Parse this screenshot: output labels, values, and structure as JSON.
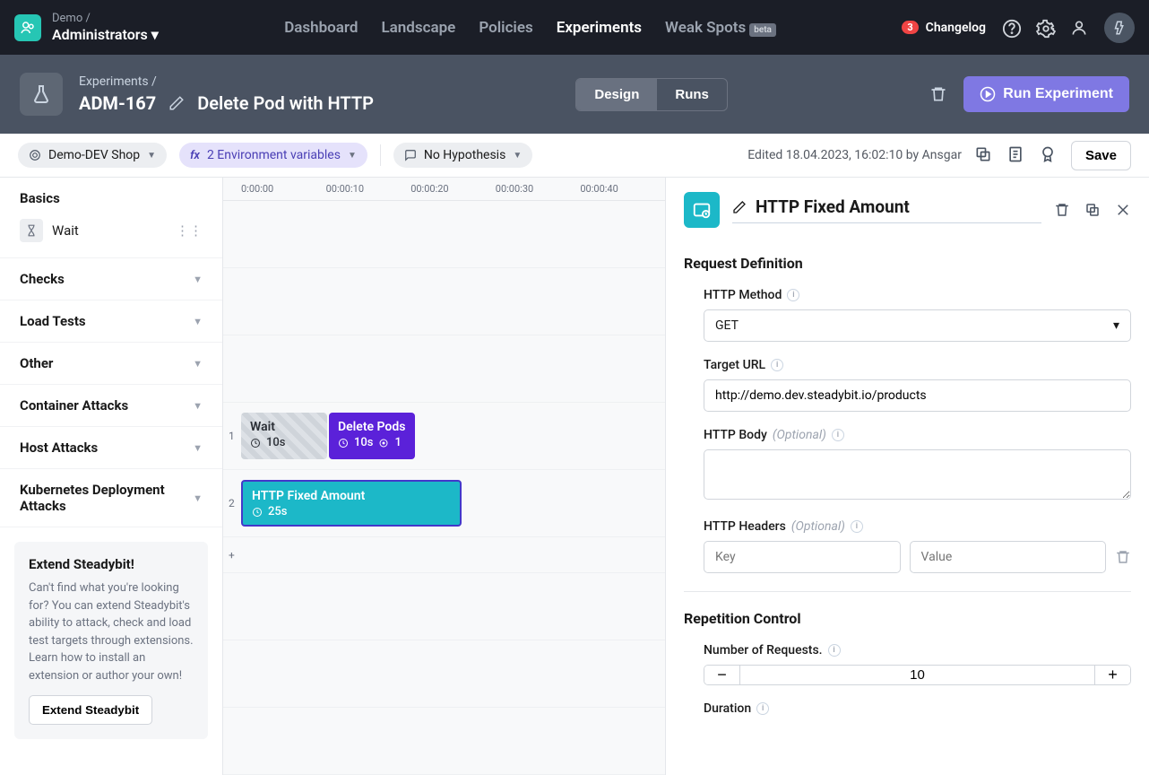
{
  "org": {
    "name": "Demo /",
    "role": "Administrators"
  },
  "nav": {
    "dashboard": "Dashboard",
    "landscape": "Landscape",
    "policies": "Policies",
    "experiments": "Experiments",
    "weakspots": "Weak Spots",
    "beta": "beta",
    "changelog": "Changelog",
    "changelog_count": "3"
  },
  "subheader": {
    "breadcrumb": "Experiments  /",
    "id": "ADM-167",
    "name": "Delete Pod with HTTP",
    "tab_design": "Design",
    "tab_runs": "Runs",
    "run_btn": "Run Experiment"
  },
  "toolbar": {
    "env": "Demo-DEV Shop",
    "vars": "2 Environment variables",
    "hypothesis": "No Hypothesis",
    "edited": "Edited 18.04.2023, 16:02:10 by Ansgar",
    "save": "Save"
  },
  "sidebar": {
    "basics": "Basics",
    "wait": "Wait",
    "checks": "Checks",
    "loadtests": "Load Tests",
    "other": "Other",
    "container": "Container Attacks",
    "host": "Host Attacks",
    "k8s": "Kubernetes Deployment Attacks",
    "ext_title": "Extend Steadybit!",
    "ext_body": "Can't find what you're looking for? You can extend Steadybit's ability to attack, check and load test targets through extensions. Learn how to install an extension or author your own!",
    "ext_btn": "Extend Steadybit"
  },
  "timeline": {
    "ticks": [
      "0:00:00",
      "00:00:10",
      "00:00:20",
      "00:00:30",
      "00:00:40"
    ],
    "row1": "1",
    "row2": "2",
    "rowplus": "+",
    "wait_label": "Wait",
    "wait_dur": "10s",
    "delete_label": "Delete Pods",
    "delete_dur": "10s",
    "delete_tgt": "1",
    "http_label": "HTTP Fixed Amount",
    "http_dur": "25s"
  },
  "panel": {
    "title": "HTTP Fixed Amount",
    "sec_request": "Request Definition",
    "lbl_method": "HTTP Method",
    "val_method": "GET",
    "lbl_url": "Target URL",
    "val_url": "http://demo.dev.steadybit.io/products",
    "lbl_body": "HTTP Body",
    "lbl_headers": "HTTP Headers",
    "optional": "(Optional)",
    "ph_key": "Key",
    "ph_value": "Value",
    "sec_repetition": "Repetition Control",
    "lbl_numreq": "Number of Requests.",
    "val_numreq": "10",
    "lbl_duration": "Duration"
  }
}
